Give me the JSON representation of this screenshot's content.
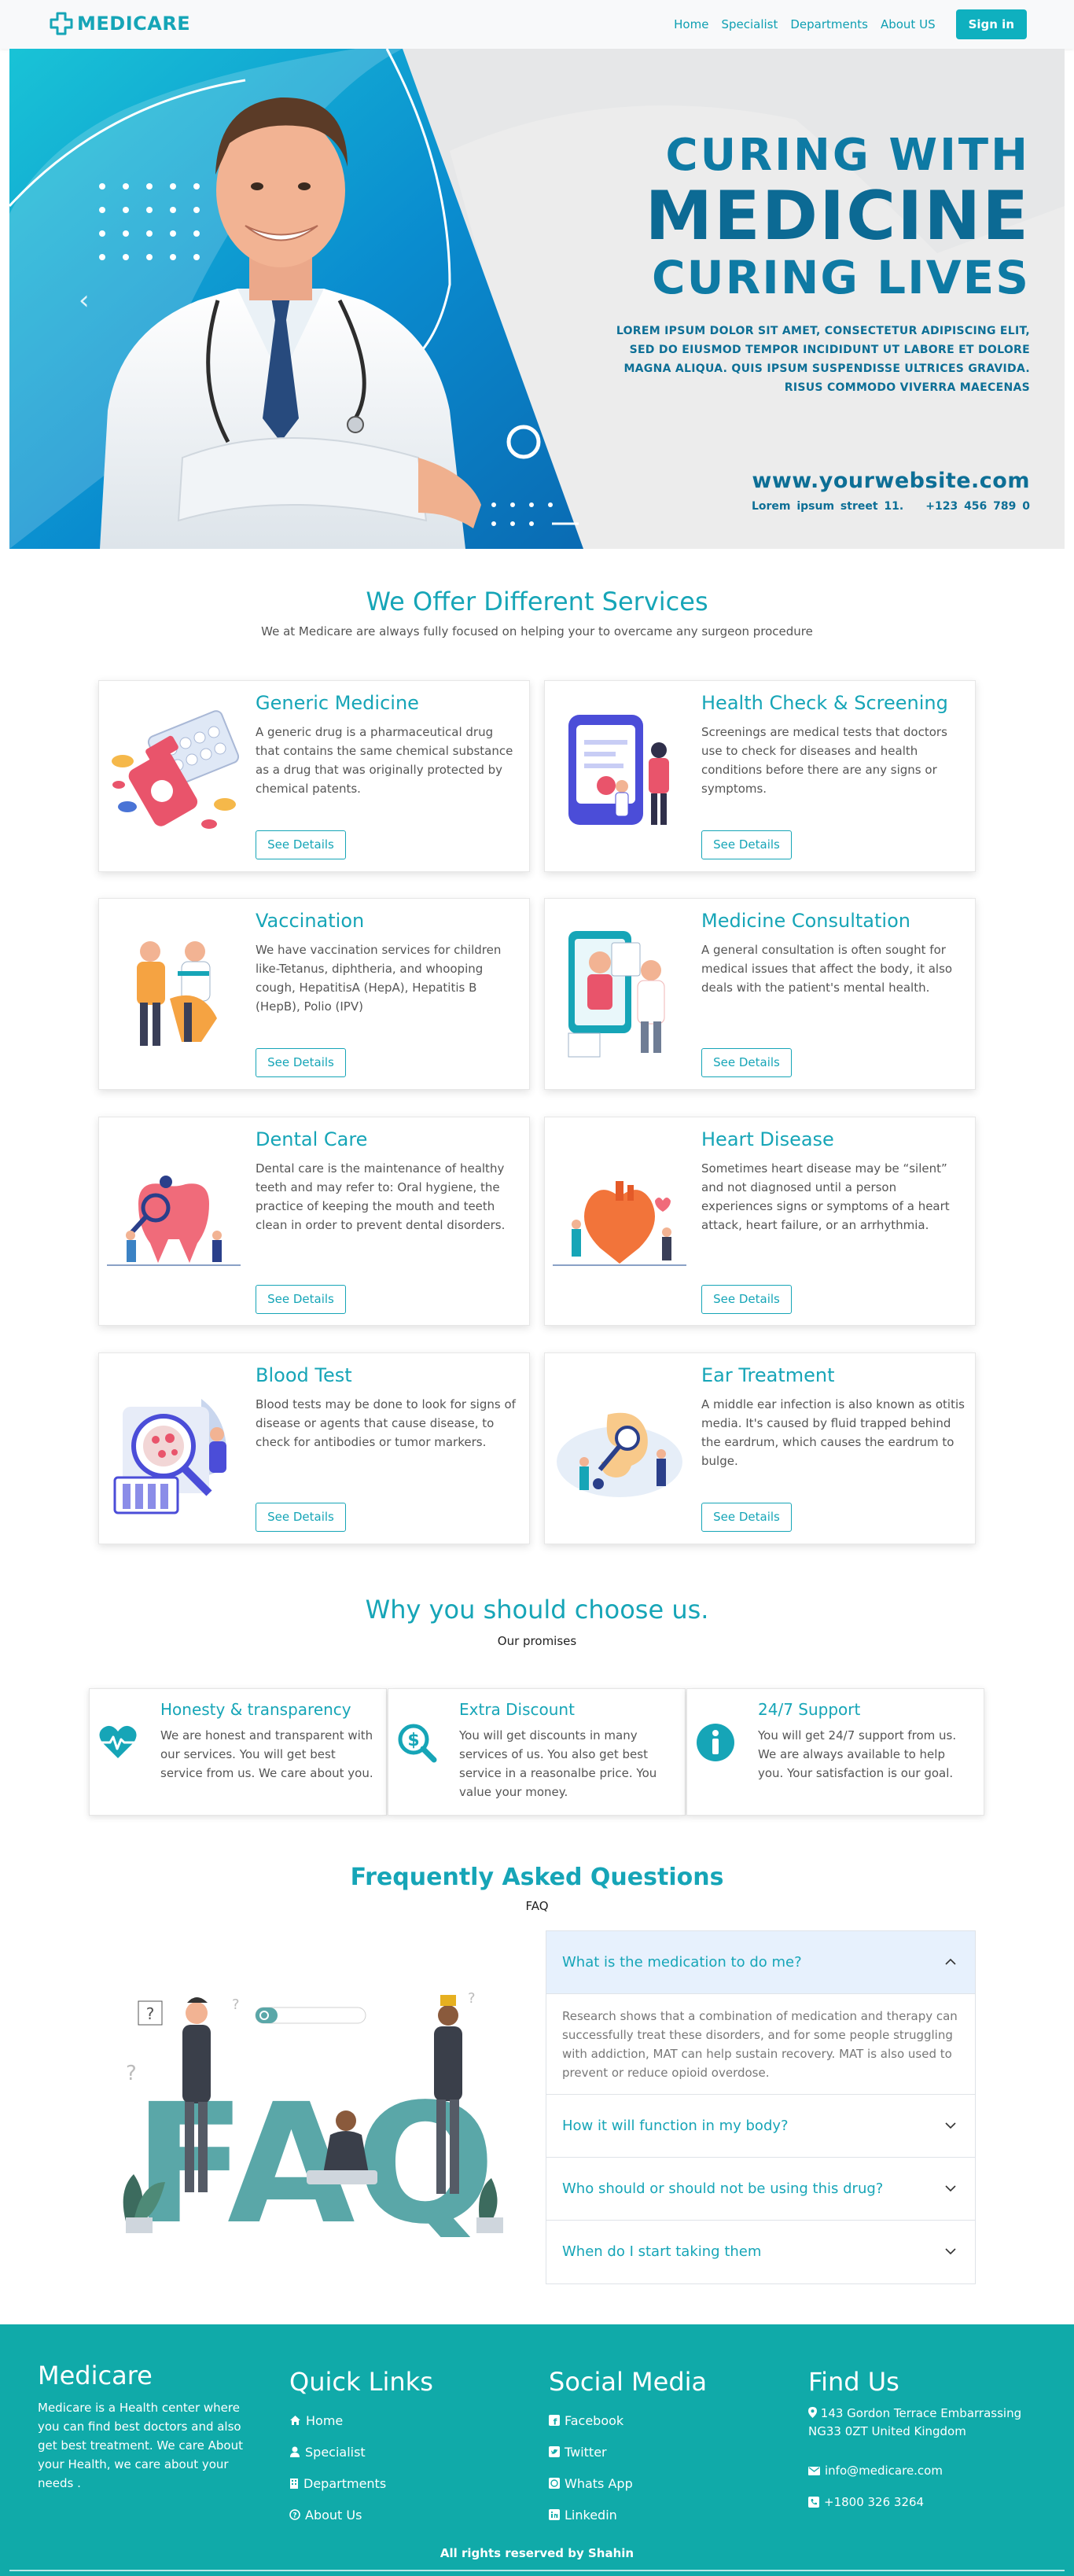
{
  "nav": {
    "brand": "MEDICARE",
    "links": [
      "Home",
      "Specialist",
      "Departments",
      "About US"
    ],
    "signin": "Sign in"
  },
  "hero": {
    "line1": "CURING WITH",
    "line2": "MEDICINE",
    "line3": "CURING LIVES",
    "paragraph": "LOREM IPSUM DOLOR SIT AMET, CONSECTETUR ADIPISCING ELIT, SED DO EIUSMOD TEMPOR INCIDIDUNT UT LABORE ET DOLORE MAGNA ALIQUA. QUIS IPSUM SUSPENDISSE ULTRICES GRAVIDA. RISUS COMMODO VIVERRA MAECENAS",
    "website": "www.yourwebsite.com",
    "address": "Lorem ipsum street 11.",
    "phone": "+123 456 789 0"
  },
  "services": {
    "title": "We Offer Different Services",
    "subtitle": "We at Medicare are always fully focused on helping your to overcame any surgeon procedure",
    "button_label": "See Details",
    "items": [
      {
        "title": "Generic Medicine",
        "text": "A generic drug is a pharmaceutical drug that contains the same chemical substance as a drug that was originally protected by chemical patents.",
        "icon": "pills-bottle-icon"
      },
      {
        "title": "Health Check & Screening",
        "text": "Screenings are medical tests that doctors use to check for diseases and health conditions before there are any signs or symptoms.",
        "icon": "screening-phone-icon"
      },
      {
        "title": "Vaccination",
        "text": "We have vaccination services for children like-Tetanus, diphtheria, and whooping cough, HepatitisA (HepA), Hepatitis B (HepB), Polio (IPV)",
        "icon": "vaccination-icon"
      },
      {
        "title": "Medicine Consultation",
        "text": "A general consultation is often sought for medical issues that affect the body, it also deals with the patient's mental health.",
        "icon": "consultation-icon"
      },
      {
        "title": "Dental Care",
        "text": "Dental care is the maintenance of healthy teeth and may refer to: Oral hygiene, the practice of keeping the mouth and teeth clean in order to prevent dental disorders.",
        "icon": "tooth-icon"
      },
      {
        "title": "Heart Disease",
        "text": "Sometimes heart disease may be “silent” and not diagnosed until a person experiences signs or symptoms of a heart attack, heart failure, or an arrhythmia.",
        "icon": "heart-organ-icon"
      },
      {
        "title": "Blood Test",
        "text": "Blood tests may be done to look for signs of disease or agents that cause disease, to check for antibodies or tumor markers.",
        "icon": "blood-test-icon"
      },
      {
        "title": "Ear Treatment",
        "text": "A middle ear infection is also known as otitis media. It's caused by fluid trapped behind the eardrum, which causes the eardrum to bulge.",
        "icon": "ear-icon"
      }
    ]
  },
  "why": {
    "title": "Why you should choose us.",
    "subtitle": "Our promises",
    "items": [
      {
        "title": "Honesty & transparency",
        "text": "We are honest and transparent with our services. You will get best service from us. We care about you.",
        "icon": "heart-pulse-icon"
      },
      {
        "title": "Extra Discount",
        "text": "You will get discounts in many services of us. You also get best service in a reasonalbe price. You value your money.",
        "icon": "dollar-search-icon"
      },
      {
        "title": "24/7 Support",
        "text": "You will get 24/7 support from us. We are always available to help you. Your satisfaction is our goal.",
        "icon": "info-icon"
      }
    ]
  },
  "faq": {
    "title": "Frequently Asked Questions",
    "subtitle": "FAQ",
    "illustration_text": "FAQ",
    "questions": [
      {
        "q": "What is the medication to do me?",
        "a": "Research shows that a combination of medication and therapy can successfully treat these disorders, and for some people struggling with addiction, MAT can help sustain recovery. MAT is also used to prevent or reduce opioid overdose."
      },
      {
        "q": "How it will function in my body?"
      },
      {
        "q": "Who should or should not be using this drug?"
      },
      {
        "q": "When do I start taking them"
      }
    ]
  },
  "footer": {
    "brand": "Medicare",
    "description": "Medicare is a Health center where you can find best doctors and also get best treatment. We care About your Health, we care about your needs .",
    "quick_links_title": "Quick Links",
    "quick_links": [
      "Home",
      "Specialist",
      "Departments",
      "About Us"
    ],
    "social_title": "Social Media",
    "social": [
      "Facebook",
      "Twitter",
      "Whats App",
      "Linkedin"
    ],
    "find_title": "Find Us",
    "address": "143 Gordon Terrace Embarrassing NG33 0ZT United Kingdom",
    "email": "info@medicare.com",
    "phone": "+1800 326 3264",
    "copyright": "All rights reserved by Shahin"
  },
  "colors": {
    "accent": "#16a5b7",
    "footer": "#10aaa9",
    "hero_text": "#0d6f96",
    "faq_open": "#e7f1fd"
  }
}
